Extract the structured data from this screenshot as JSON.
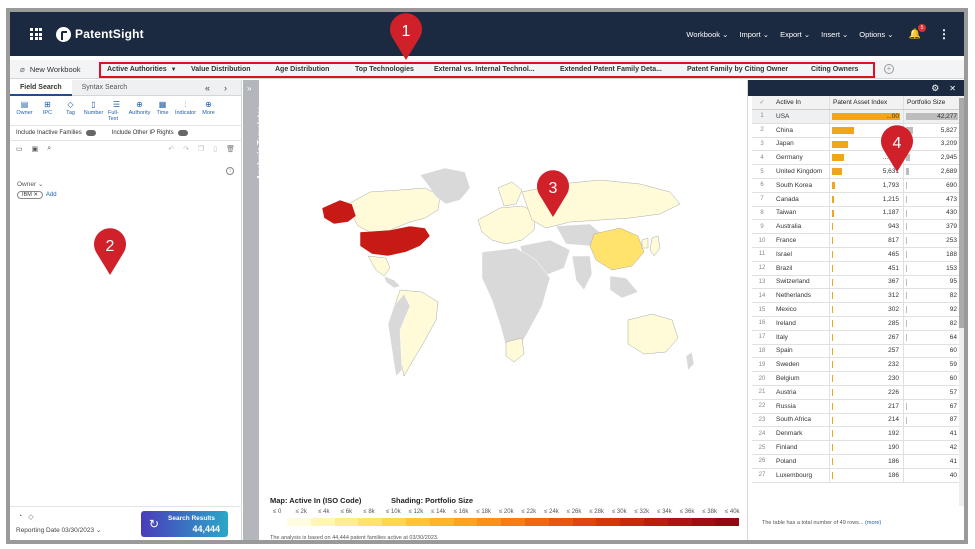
{
  "app": {
    "brand": "PatentSight"
  },
  "topmenu": {
    "items": [
      "Workbook",
      "Import",
      "Export",
      "Insert",
      "Options"
    ],
    "bell_badge": "5"
  },
  "tabbar": {
    "workbook_label": "New Workbook",
    "tabs": [
      "Active Authorities",
      "Value Distribution",
      "Age Distribution",
      "Top Technologies",
      "External vs. Internal Technol...",
      "Extended Patent Family Deta...",
      "Patent Family by Citing Owner",
      "Citing Owners"
    ]
  },
  "leftpanel": {
    "subtabs": [
      "Field Search",
      "Syntax Search"
    ],
    "tools": [
      "Owner",
      "IPC",
      "Tag",
      "Number",
      "Full-Text",
      "Authority",
      "Time",
      "Indicator",
      "More"
    ],
    "toggles": [
      "Include Inactive Families",
      "Include Other IP Rights"
    ],
    "owner_label": "Owner",
    "owner_chip": "IBM",
    "add_label": "Add",
    "reporting_date": "Reporting Date 03/30/2023",
    "search_btn_label": "Search Results",
    "search_btn_count": "44,444"
  },
  "analysis_templates": {
    "label": "Analysis Templates"
  },
  "map": {
    "legend_title": "Map: Active In (ISO Code)",
    "shading_title": "Shading: Portfolio Size",
    "legend_ticks": [
      "≤ 0",
      "≤ 2k",
      "≤ 4k",
      "≤ 6k",
      "≤ 8k",
      "≤ 10k",
      "≤ 12k",
      "≤ 14k",
      "≤ 16k",
      "≤ 18k",
      "≤ 20k",
      "≤ 22k",
      "≤ 24k",
      "≤ 26k",
      "≤ 28k",
      "≤ 30k",
      "≤ 32k",
      "≤ 34k",
      "≤ 36k",
      "≤ 38k",
      "≤ 40k"
    ],
    "legend_colors": [
      "#fffce0",
      "#fff6b8",
      "#ffee90",
      "#ffe36c",
      "#ffd64c",
      "#ffc634",
      "#ffb526",
      "#ffa31c",
      "#fd9016",
      "#f87c12",
      "#f2680f",
      "#ea560e",
      "#e1440e",
      "#d6350f",
      "#ca2810",
      "#bd1d11",
      "#b01412",
      "#a20d12",
      "#940812"
    ],
    "footnote": "The analysis is based on 44,444 patent families active at 03/30/2023."
  },
  "table": {
    "headers": [
      "Active In",
      "Patent Asset Index",
      "Portfolio Size"
    ],
    "rows": [
      {
        "n": "1",
        "name": "USA",
        "pai": "...00",
        "ps": "42,277",
        "pai_frac": 1.0,
        "ps_frac": 1.0
      },
      {
        "n": "2",
        "name": "China",
        "pai": "...3",
        "ps": "5,827",
        "pai_frac": 0.32,
        "ps_frac": 0.14
      },
      {
        "n": "3",
        "name": "Japan",
        "pai": "...172",
        "ps": "3,209",
        "pai_frac": 0.23,
        "ps_frac": 0.08
      },
      {
        "n": "4",
        "name": "Germany",
        "pai": "...344",
        "ps": "2,945",
        "pai_frac": 0.17,
        "ps_frac": 0.07
      },
      {
        "n": "5",
        "name": "United Kingdom",
        "pai": "5,631",
        "ps": "2,689",
        "pai_frac": 0.14,
        "ps_frac": 0.06
      },
      {
        "n": "6",
        "name": "South Korea",
        "pai": "1,793",
        "ps": "690",
        "pai_frac": 0.05,
        "ps_frac": 0.02
      },
      {
        "n": "7",
        "name": "Canada",
        "pai": "1,215",
        "ps": "473",
        "pai_frac": 0.03,
        "ps_frac": 0.01
      },
      {
        "n": "8",
        "name": "Taiwan",
        "pai": "1,187",
        "ps": "430",
        "pai_frac": 0.03,
        "ps_frac": 0.01
      },
      {
        "n": "9",
        "name": "Australia",
        "pai": "943",
        "ps": "379",
        "pai_frac": 0.02,
        "ps_frac": 0.01
      },
      {
        "n": "10",
        "name": "France",
        "pai": "817",
        "ps": "253",
        "pai_frac": 0.02,
        "ps_frac": 0.01
      },
      {
        "n": "11",
        "name": "Israel",
        "pai": "465",
        "ps": "188",
        "pai_frac": 0.01,
        "ps_frac": 0.004
      },
      {
        "n": "12",
        "name": "Brazil",
        "pai": "451",
        "ps": "153",
        "pai_frac": 0.01,
        "ps_frac": 0.004
      },
      {
        "n": "13",
        "name": "Switzerland",
        "pai": "367",
        "ps": "95",
        "pai_frac": 0.01,
        "ps_frac": 0.002
      },
      {
        "n": "14",
        "name": "Netherlands",
        "pai": "312",
        "ps": "82",
        "pai_frac": 0.01,
        "ps_frac": 0.002
      },
      {
        "n": "15",
        "name": "Mexico",
        "pai": "302",
        "ps": "92",
        "pai_frac": 0.01,
        "ps_frac": 0.002
      },
      {
        "n": "16",
        "name": "Ireland",
        "pai": "285",
        "ps": "82",
        "pai_frac": 0.01,
        "ps_frac": 0.002
      },
      {
        "n": "17",
        "name": "Italy",
        "pai": "267",
        "ps": "64",
        "pai_frac": 0.01,
        "ps_frac": 0.002
      },
      {
        "n": "18",
        "name": "Spain",
        "pai": "257",
        "ps": "60",
        "pai_frac": 0.01,
        "ps_frac": 0.001
      },
      {
        "n": "19",
        "name": "Sweden",
        "pai": "232",
        "ps": "59",
        "pai_frac": 0.01,
        "ps_frac": 0.001
      },
      {
        "n": "20",
        "name": "Belgium",
        "pai": "230",
        "ps": "60",
        "pai_frac": 0.01,
        "ps_frac": 0.001
      },
      {
        "n": "21",
        "name": "Austria",
        "pai": "226",
        "ps": "57",
        "pai_frac": 0.01,
        "ps_frac": 0.001
      },
      {
        "n": "22",
        "name": "Russia",
        "pai": "217",
        "ps": "67",
        "pai_frac": 0.01,
        "ps_frac": 0.002
      },
      {
        "n": "23",
        "name": "South Africa",
        "pai": "214",
        "ps": "87",
        "pai_frac": 0.01,
        "ps_frac": 0.002
      },
      {
        "n": "24",
        "name": "Denmark",
        "pai": "192",
        "ps": "41",
        "pai_frac": 0.01,
        "ps_frac": 0.001
      },
      {
        "n": "25",
        "name": "Finland",
        "pai": "190",
        "ps": "42",
        "pai_frac": 0.01,
        "ps_frac": 0.001
      },
      {
        "n": "26",
        "name": "Poland",
        "pai": "186",
        "ps": "41",
        "pai_frac": 0.01,
        "ps_frac": 0.001
      },
      {
        "n": "27",
        "name": "Luxembourg",
        "pai": "186",
        "ps": "40",
        "pai_frac": 0.01,
        "ps_frac": 0.001
      }
    ],
    "footer_text": "The table has a total number of 49 rows...",
    "footer_more": "(more)"
  },
  "callouts": [
    "1",
    "2",
    "3",
    "4"
  ],
  "colors": {
    "header_bg": "#1b2a40",
    "highlight_red": "#e0101e",
    "pin_red": "#d0202a",
    "map_usa": "#c81a14",
    "map_light": "#fffbd8",
    "map_gray": "#d9d9d9",
    "pai_bar": "#f2a51a"
  }
}
